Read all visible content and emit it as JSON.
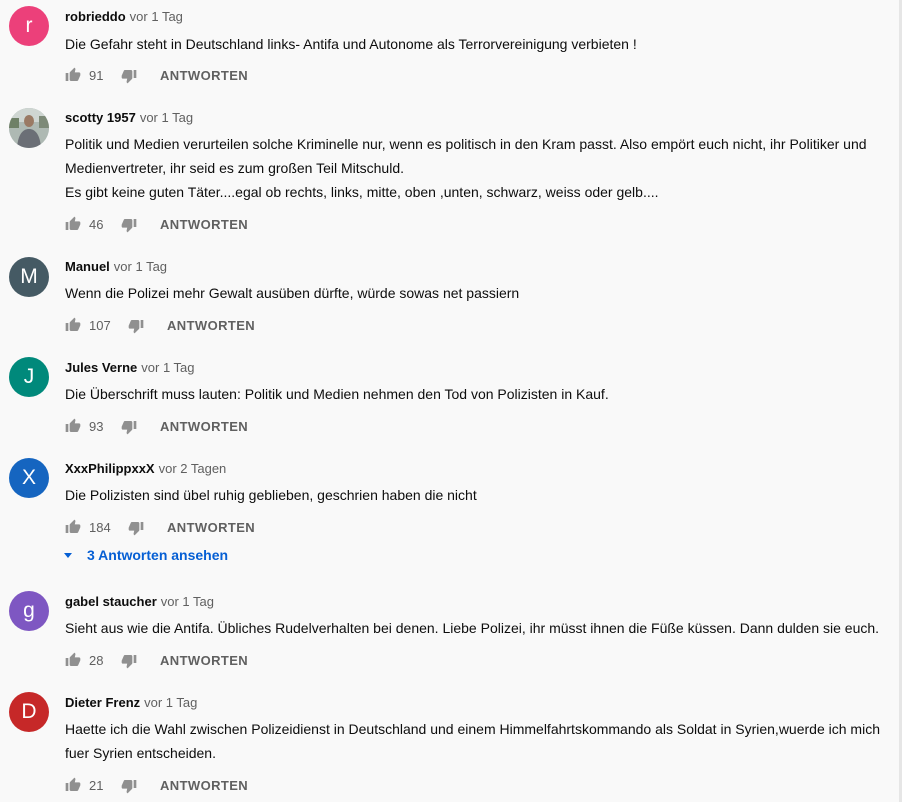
{
  "comments": [
    {
      "author": "robrieddo",
      "time": "vor 1 Tag",
      "avatar_letter": "r",
      "avatar_color": "#ec407a",
      "text": [
        "Die Gefahr steht in Deutschland links- Antifa und Autonome als Terrorvereinigung verbieten !"
      ],
      "likes": "91",
      "reply_label": "ANTWORTEN"
    },
    {
      "author": "scotty 1957",
      "time": "vor 1 Tag",
      "avatar_letter": "",
      "avatar_color": "#b9c6c9",
      "text": [
        "Politik und Medien verurteilen solche Kriminelle nur, wenn es politisch in den Kram passt. Also empört euch nicht, ihr Politiker und",
        "Medienvertreter, ihr seid es zum großen Teil Mitschuld.",
        "Es gibt keine guten Täter....egal ob rechts, links, mitte, oben ,unten, schwarz, weiss oder gelb...."
      ],
      "likes": "46",
      "reply_label": "ANTWORTEN"
    },
    {
      "author": "Manuel",
      "time": "vor 1 Tag",
      "avatar_letter": "M",
      "avatar_color": "#455a64",
      "text": [
        "Wenn die Polizei mehr Gewalt ausüben dürfte, würde sowas net passiern"
      ],
      "likes": "107",
      "reply_label": "ANTWORTEN"
    },
    {
      "author": "Jules Verne",
      "time": "vor 1 Tag",
      "avatar_letter": "J",
      "avatar_color": "#00897b",
      "text": [
        "Die Überschrift muss lauten: Politik und Medien nehmen den Tod von Polizisten in Kauf."
      ],
      "likes": "93",
      "reply_label": "ANTWORTEN"
    },
    {
      "author": "XxxPhilippxxX",
      "time": "vor 2 Tagen",
      "avatar_letter": "X",
      "avatar_color": "#1565c0",
      "text": [
        "Die Polizisten sind übel ruhig geblieben, geschrien haben die nicht"
      ],
      "likes": "184",
      "reply_label": "ANTWORTEN",
      "replies_label": "3 Antworten ansehen"
    },
    {
      "author": "gabel staucher",
      "time": "vor 1 Tag",
      "avatar_letter": "g",
      "avatar_color": "#7e57c2",
      "text": [
        "Sieht aus wie die Antifa. Übliches Rudelverhalten bei denen. Liebe Polizei, ihr müsst ihnen die Füße küssen. Dann dulden sie euch."
      ],
      "likes": "28",
      "reply_label": "ANTWORTEN"
    },
    {
      "author": "Dieter Frenz",
      "time": "vor 1 Tag",
      "avatar_letter": "D",
      "avatar_color": "#c62828",
      "text": [
        "Haette ich die Wahl zwischen Polizeidienst in Deutschland und einem Himmelfahrtskommando als Soldat in Syrien,wuerde ich mich",
        "fuer Syrien entscheiden."
      ],
      "likes": "21",
      "reply_label": "ANTWORTEN"
    }
  ],
  "icons": {
    "like": "thumb-up-icon",
    "dislike": "thumb-down-icon",
    "replies_toggle": "caret-down-icon"
  },
  "colors": {
    "link": "#065fd4",
    "secondary_text": "#606060"
  }
}
